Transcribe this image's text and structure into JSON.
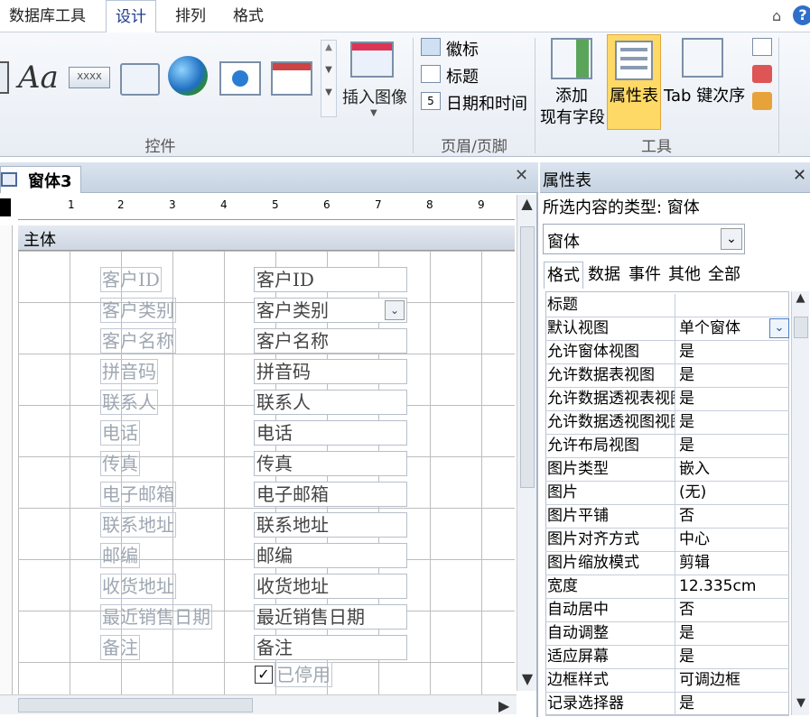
{
  "ribbon_tabs": [
    "数据库工具",
    "设计",
    "排列",
    "格式"
  ],
  "ribbon": {
    "insert_image": "插入图像",
    "header_footer_items": [
      "徽标",
      "标题",
      "日期和时间"
    ],
    "add_fields_line1": "添加",
    "add_fields_line2": "现有字段",
    "property_sheet": "属性表",
    "tab_order": "Tab 键次序",
    "groups": {
      "controls": "控件",
      "header_footer": "页眉/页脚",
      "tools": "工具"
    }
  },
  "document": {
    "tab_title": "窗体3",
    "section": "主体",
    "ruler": [
      "1",
      "2",
      "3",
      "4",
      "5",
      "6",
      "7",
      "8",
      "9"
    ],
    "labels": [
      "客户ID",
      "客户类别",
      "客户名称",
      "拼音码",
      "联系人",
      "电话",
      "传真",
      "电子邮箱",
      "联系地址",
      "邮编",
      "收货地址",
      "最近销售日期",
      "备注"
    ],
    "fields": [
      "客户ID",
      "客户类别",
      "客户名称",
      "拼音码",
      "联系人",
      "电话",
      "传真",
      "电子邮箱",
      "联系地址",
      "邮编",
      "收货地址",
      "最近销售日期",
      "备注"
    ],
    "checkbox_label": "已停用",
    "checkbox_checked": true
  },
  "property_sheet": {
    "title": "属性表",
    "selection_type": "所选内容的类型: 窗体",
    "object": "窗体",
    "tabs": [
      "格式",
      "数据",
      "事件",
      "其他",
      "全部"
    ],
    "active_tab": "格式",
    "rows": [
      {
        "key": "标题",
        "value": ""
      },
      {
        "key": "默认视图",
        "value": "单个窗体"
      },
      {
        "key": "允许窗体视图",
        "value": "是"
      },
      {
        "key": "允许数据表视图",
        "value": "是"
      },
      {
        "key": "允许数据透视表视图",
        "value": "是"
      },
      {
        "key": "允许数据透视图视图",
        "value": "是"
      },
      {
        "key": "允许布局视图",
        "value": "是"
      },
      {
        "key": "图片类型",
        "value": "嵌入"
      },
      {
        "key": "图片",
        "value": "(无)"
      },
      {
        "key": "图片平铺",
        "value": "否"
      },
      {
        "key": "图片对齐方式",
        "value": "中心"
      },
      {
        "key": "图片缩放模式",
        "value": "剪辑"
      },
      {
        "key": "宽度",
        "value": "12.335cm"
      },
      {
        "key": "自动居中",
        "value": "否"
      },
      {
        "key": "自动调整",
        "value": "是"
      },
      {
        "key": "适应屏幕",
        "value": "是"
      },
      {
        "key": "边框样式",
        "value": "可调边框"
      },
      {
        "key": "记录选择器",
        "value": "是"
      }
    ]
  },
  "colors": {
    "accent": "#1e3a8a",
    "highlight": "#ffd966",
    "ribbon_bg": "#eef2f8",
    "doc_header": "#c7d3e2"
  }
}
